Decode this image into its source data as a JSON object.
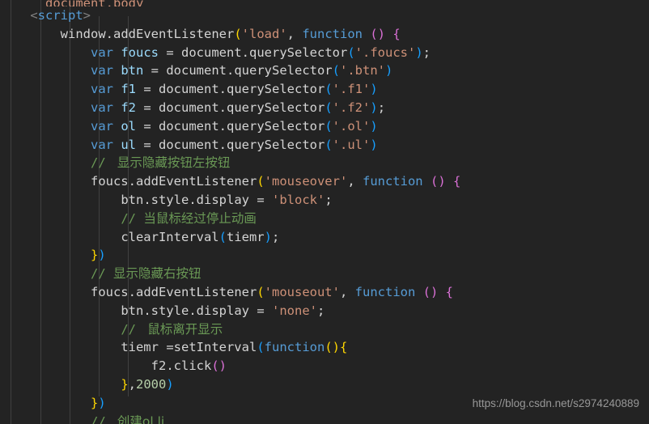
{
  "editor": {
    "background_color": "#232323",
    "default_text_color": "#d4d4d4",
    "font_size_px": 15.5,
    "line_height_px": 22.8,
    "indent_guide_color": "#404040",
    "indent_guides_x": [
      13,
      50,
      86,
      122,
      158
    ]
  },
  "colors": {
    "keyword": "#569cd6",
    "variable": "#9cdcfe",
    "string": "#ce9178",
    "number": "#b5cea8",
    "comment": "#6a9955",
    "function": "#dcdcaa",
    "plain": "#d4d4d4",
    "bracket_yellow": "#ffd700",
    "bracket_purple": "#da70d6",
    "bracket_blue": "#179fff"
  },
  "watermark": {
    "text": "https://blog.csdn.net/s2974240889",
    "color": "#9e9e9e"
  },
  "code": {
    "language": "html-javascript",
    "lines": [
      {
        "indent": 0,
        "partial": true,
        "tokens": [
          {
            "t": "      ",
            "c": "plain"
          },
          {
            "t": "document.body",
            "c": "string"
          },
          {
            "t": "      ",
            "c": "plain"
          }
        ]
      },
      {
        "indent": 0,
        "tokens": [
          {
            "t": "    ",
            "c": "plain"
          },
          {
            "t": "<",
            "c": "punct"
          },
          {
            "t": "script",
            "c": "tag"
          },
          {
            "t": ">",
            "c": "punct"
          }
        ]
      },
      {
        "indent": 1,
        "tokens": [
          {
            "t": "        ",
            "c": "plain"
          },
          {
            "t": "window",
            "c": "plain"
          },
          {
            "t": ".",
            "c": "plain"
          },
          {
            "t": "addEventListener",
            "c": "plain"
          },
          {
            "t": "(",
            "c": "b1"
          },
          {
            "t": "'load'",
            "c": "string"
          },
          {
            "t": ", ",
            "c": "plain"
          },
          {
            "t": "function",
            "c": "keyword"
          },
          {
            "t": " ",
            "c": "plain"
          },
          {
            "t": "()",
            "c": "b2"
          },
          {
            "t": " ",
            "c": "plain"
          },
          {
            "t": "{",
            "c": "b2"
          }
        ]
      },
      {
        "indent": 2,
        "tokens": [
          {
            "t": "            ",
            "c": "plain"
          },
          {
            "t": "var",
            "c": "keyword"
          },
          {
            "t": " ",
            "c": "plain"
          },
          {
            "t": "foucs",
            "c": "var"
          },
          {
            "t": " = ",
            "c": "plain"
          },
          {
            "t": "document",
            "c": "plain"
          },
          {
            "t": ".",
            "c": "plain"
          },
          {
            "t": "querySelector",
            "c": "plain"
          },
          {
            "t": "(",
            "c": "b3"
          },
          {
            "t": "'.foucs'",
            "c": "string"
          },
          {
            "t": ")",
            "c": "b3"
          },
          {
            "t": ";",
            "c": "plain"
          }
        ]
      },
      {
        "indent": 2,
        "tokens": [
          {
            "t": "            ",
            "c": "plain"
          },
          {
            "t": "var",
            "c": "keyword"
          },
          {
            "t": " ",
            "c": "plain"
          },
          {
            "t": "btn",
            "c": "var"
          },
          {
            "t": " = ",
            "c": "plain"
          },
          {
            "t": "document",
            "c": "plain"
          },
          {
            "t": ".",
            "c": "plain"
          },
          {
            "t": "querySelector",
            "c": "plain"
          },
          {
            "t": "(",
            "c": "b3"
          },
          {
            "t": "'.btn'",
            "c": "string"
          },
          {
            "t": ")",
            "c": "b3"
          }
        ]
      },
      {
        "indent": 2,
        "tokens": [
          {
            "t": "            ",
            "c": "plain"
          },
          {
            "t": "var",
            "c": "keyword"
          },
          {
            "t": " ",
            "c": "plain"
          },
          {
            "t": "f1",
            "c": "var"
          },
          {
            "t": " = ",
            "c": "plain"
          },
          {
            "t": "document",
            "c": "plain"
          },
          {
            "t": ".",
            "c": "plain"
          },
          {
            "t": "querySelector",
            "c": "plain"
          },
          {
            "t": "(",
            "c": "b3"
          },
          {
            "t": "'.f1'",
            "c": "string"
          },
          {
            "t": ")",
            "c": "b3"
          }
        ]
      },
      {
        "indent": 2,
        "tokens": [
          {
            "t": "            ",
            "c": "plain"
          },
          {
            "t": "var",
            "c": "keyword"
          },
          {
            "t": " ",
            "c": "plain"
          },
          {
            "t": "f2",
            "c": "var"
          },
          {
            "t": " = ",
            "c": "plain"
          },
          {
            "t": "document",
            "c": "plain"
          },
          {
            "t": ".",
            "c": "plain"
          },
          {
            "t": "querySelector",
            "c": "plain"
          },
          {
            "t": "(",
            "c": "b3"
          },
          {
            "t": "'.f2'",
            "c": "string"
          },
          {
            "t": ")",
            "c": "b3"
          },
          {
            "t": ";",
            "c": "plain"
          }
        ]
      },
      {
        "indent": 2,
        "tokens": [
          {
            "t": "            ",
            "c": "plain"
          },
          {
            "t": "var",
            "c": "keyword"
          },
          {
            "t": " ",
            "c": "plain"
          },
          {
            "t": "ol",
            "c": "var"
          },
          {
            "t": " = ",
            "c": "plain"
          },
          {
            "t": "document",
            "c": "plain"
          },
          {
            "t": ".",
            "c": "plain"
          },
          {
            "t": "querySelector",
            "c": "plain"
          },
          {
            "t": "(",
            "c": "b3"
          },
          {
            "t": "'.ol'",
            "c": "string"
          },
          {
            "t": ")",
            "c": "b3"
          }
        ]
      },
      {
        "indent": 2,
        "tokens": [
          {
            "t": "            ",
            "c": "plain"
          },
          {
            "t": "var",
            "c": "keyword"
          },
          {
            "t": " ",
            "c": "plain"
          },
          {
            "t": "ul",
            "c": "var"
          },
          {
            "t": " = ",
            "c": "plain"
          },
          {
            "t": "document",
            "c": "plain"
          },
          {
            "t": ".",
            "c": "plain"
          },
          {
            "t": "querySelector",
            "c": "plain"
          },
          {
            "t": "(",
            "c": "b3"
          },
          {
            "t": "'.ul'",
            "c": "string"
          },
          {
            "t": ")",
            "c": "b3"
          }
        ]
      },
      {
        "indent": 2,
        "tokens": [
          {
            "t": "            ",
            "c": "plain"
          },
          {
            "t": "// ",
            "c": "comment"
          },
          {
            "t": " 显示隐藏按钮左按钮",
            "c": "comment",
            "cjk": true
          }
        ]
      },
      {
        "indent": 2,
        "tokens": [
          {
            "t": "            ",
            "c": "plain"
          },
          {
            "t": "foucs",
            "c": "plain"
          },
          {
            "t": ".",
            "c": "plain"
          },
          {
            "t": "addEventListener",
            "c": "plain"
          },
          {
            "t": "(",
            "c": "b1"
          },
          {
            "t": "'mouseover'",
            "c": "string"
          },
          {
            "t": ", ",
            "c": "plain"
          },
          {
            "t": "function",
            "c": "keyword"
          },
          {
            "t": " ",
            "c": "plain"
          },
          {
            "t": "()",
            "c": "b2"
          },
          {
            "t": " ",
            "c": "plain"
          },
          {
            "t": "{",
            "c": "b2"
          }
        ]
      },
      {
        "indent": 3,
        "tokens": [
          {
            "t": "                ",
            "c": "plain"
          },
          {
            "t": "btn",
            "c": "plain"
          },
          {
            "t": ".",
            "c": "plain"
          },
          {
            "t": "style",
            "c": "plain"
          },
          {
            "t": ".",
            "c": "plain"
          },
          {
            "t": "display",
            "c": "plain"
          },
          {
            "t": " = ",
            "c": "plain"
          },
          {
            "t": "'block'",
            "c": "string"
          },
          {
            "t": ";",
            "c": "plain"
          }
        ]
      },
      {
        "indent": 3,
        "tokens": [
          {
            "t": "                ",
            "c": "plain"
          },
          {
            "t": "// ",
            "c": "comment"
          },
          {
            "t": "当鼠标经过停止动画",
            "c": "comment",
            "cjk": true
          }
        ]
      },
      {
        "indent": 3,
        "tokens": [
          {
            "t": "                ",
            "c": "plain"
          },
          {
            "t": "clearInterval",
            "c": "plain"
          },
          {
            "t": "(",
            "c": "b3"
          },
          {
            "t": "tiemr",
            "c": "plain"
          },
          {
            "t": ")",
            "c": "b3"
          },
          {
            "t": ";",
            "c": "plain"
          }
        ]
      },
      {
        "indent": 2,
        "tokens": [
          {
            "t": "            ",
            "c": "plain"
          },
          {
            "t": "}",
            "c": "b1"
          },
          {
            "t": ")",
            "c": "b3"
          }
        ]
      },
      {
        "indent": 2,
        "tokens": [
          {
            "t": "            ",
            "c": "plain"
          },
          {
            "t": "// ",
            "c": "comment"
          },
          {
            "t": "显示隐藏右按钮",
            "c": "comment",
            "cjk": true
          }
        ]
      },
      {
        "indent": 2,
        "tokens": [
          {
            "t": "            ",
            "c": "plain"
          },
          {
            "t": "foucs",
            "c": "plain"
          },
          {
            "t": ".",
            "c": "plain"
          },
          {
            "t": "addEventListener",
            "c": "plain"
          },
          {
            "t": "(",
            "c": "b1"
          },
          {
            "t": "'mouseout'",
            "c": "string"
          },
          {
            "t": ", ",
            "c": "plain"
          },
          {
            "t": "function",
            "c": "keyword"
          },
          {
            "t": " ",
            "c": "plain"
          },
          {
            "t": "()",
            "c": "b2"
          },
          {
            "t": " ",
            "c": "plain"
          },
          {
            "t": "{",
            "c": "b2"
          }
        ]
      },
      {
        "indent": 3,
        "tokens": [
          {
            "t": "                ",
            "c": "plain"
          },
          {
            "t": "btn",
            "c": "plain"
          },
          {
            "t": ".",
            "c": "plain"
          },
          {
            "t": "style",
            "c": "plain"
          },
          {
            "t": ".",
            "c": "plain"
          },
          {
            "t": "display",
            "c": "plain"
          },
          {
            "t": " = ",
            "c": "plain"
          },
          {
            "t": "'none'",
            "c": "string"
          },
          {
            "t": ";",
            "c": "plain"
          }
        ]
      },
      {
        "indent": 3,
        "tokens": [
          {
            "t": "                ",
            "c": "plain"
          },
          {
            "t": "// ",
            "c": "comment"
          },
          {
            "t": " 鼠标离开显示",
            "c": "comment",
            "cjk": true
          }
        ]
      },
      {
        "indent": 3,
        "tokens": [
          {
            "t": "                ",
            "c": "plain"
          },
          {
            "t": "tiemr",
            "c": "plain"
          },
          {
            "t": " =",
            "c": "plain"
          },
          {
            "t": "setInterval",
            "c": "plain"
          },
          {
            "t": "(",
            "c": "b3"
          },
          {
            "t": "function",
            "c": "keyword"
          },
          {
            "t": "()",
            "c": "b1"
          },
          {
            "t": "{",
            "c": "b1"
          }
        ]
      },
      {
        "indent": 4,
        "tokens": [
          {
            "t": "                    ",
            "c": "plain"
          },
          {
            "t": "f2",
            "c": "plain"
          },
          {
            "t": ".",
            "c": "plain"
          },
          {
            "t": "click",
            "c": "plain"
          },
          {
            "t": "()",
            "c": "b2"
          }
        ]
      },
      {
        "indent": 3,
        "tokens": [
          {
            "t": "                ",
            "c": "plain"
          },
          {
            "t": "}",
            "c": "b1"
          },
          {
            "t": ",",
            "c": "plain"
          },
          {
            "t": "2000",
            "c": "number"
          },
          {
            "t": ")",
            "c": "b3"
          }
        ]
      },
      {
        "indent": 2,
        "tokens": [
          {
            "t": "            ",
            "c": "plain"
          },
          {
            "t": "}",
            "c": "b1"
          },
          {
            "t": ")",
            "c": "b3"
          }
        ]
      },
      {
        "indent": 2,
        "tokens": [
          {
            "t": "            ",
            "c": "plain"
          },
          {
            "t": "// ",
            "c": "comment"
          },
          {
            "t": " 创建ol li",
            "c": "comment",
            "cjk": true
          }
        ]
      }
    ]
  }
}
